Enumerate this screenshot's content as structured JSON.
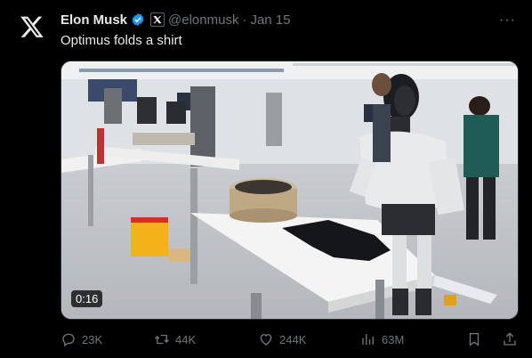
{
  "tweet": {
    "author_name": "Elon Musk",
    "handle": "@elonmusk",
    "separator": "·",
    "date": "Jan 15",
    "text": "Optimus folds a shirt",
    "more_label": "···"
  },
  "video": {
    "timecode": "0:16"
  },
  "actions": {
    "replies": "23K",
    "reposts": "44K",
    "likes": "244K",
    "views": "63M"
  },
  "icons": {
    "logo": "x-logo-icon",
    "verified": "verified-badge-icon",
    "affiliation": "x-affiliation-icon",
    "reply": "reply-icon",
    "repost": "repost-icon",
    "like": "heart-icon",
    "views": "views-chart-icon",
    "bookmark": "bookmark-icon",
    "share": "share-icon"
  },
  "colors": {
    "background": "#000000",
    "text": "#e7e9ea",
    "muted": "#71767b",
    "verified": "#1d9bf0"
  }
}
